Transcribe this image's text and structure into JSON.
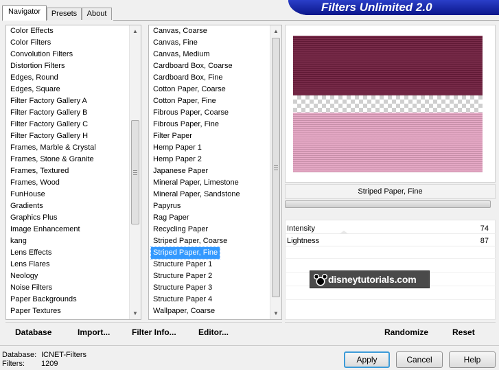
{
  "title": "Filters Unlimited 2.0",
  "tabs": [
    "Navigator",
    "Presets",
    "About"
  ],
  "categories": [
    "Color Effects",
    "Color Filters",
    "Convolution Filters",
    "Distortion Filters",
    "Edges, Round",
    "Edges, Square",
    "Filter Factory Gallery A",
    "Filter Factory Gallery B",
    "Filter Factory Gallery C",
    "Filter Factory Gallery H",
    "Frames, Marble & Crystal",
    "Frames, Stone & Granite",
    "Frames, Textured",
    "Frames, Wood",
    "FunHouse",
    "Gradients",
    "Graphics Plus",
    "Image Enhancement",
    "kang",
    "Lens Effects",
    "Lens Flares",
    "Neology",
    "Noise Filters",
    "Paper Backgrounds",
    "Paper Textures"
  ],
  "filters": [
    "Canvas, Coarse",
    "Canvas, Fine",
    "Canvas, Medium",
    "Cardboard Box, Coarse",
    "Cardboard Box, Fine",
    "Cotton Paper, Coarse",
    "Cotton Paper, Fine",
    "Fibrous Paper, Coarse",
    "Fibrous Paper, Fine",
    "Filter Paper",
    "Hemp Paper 1",
    "Hemp Paper 2",
    "Japanese Paper",
    "Mineral Paper, Limestone",
    "Mineral Paper, Sandstone",
    "Papyrus",
    "Rag Paper",
    "Recycling Paper",
    "Striped Paper, Coarse",
    "Striped Paper, Fine",
    "Structure Paper 1",
    "Structure Paper 2",
    "Structure Paper 3",
    "Structure Paper 4",
    "Wallpaper, Coarse"
  ],
  "selected_filter": "Striped Paper, Fine",
  "preview": {
    "top_color": "#6e1d3d",
    "bottom_color": "#e3a3c1"
  },
  "params": [
    {
      "label": "Intensity",
      "value": "74"
    },
    {
      "label": "Lightness",
      "value": "87"
    }
  ],
  "watermark": "disneytutorials.com",
  "list_buttons": {
    "database": "Database",
    "import": "Import...",
    "filter_info": "Filter Info...",
    "editor": "Editor..."
  },
  "right_buttons": {
    "randomize": "Randomize",
    "reset": "Reset"
  },
  "status": {
    "database_label": "Database:",
    "database_value": "ICNET-Filters",
    "filters_label": "Filters:",
    "filters_value": "1209"
  },
  "dialog_buttons": {
    "apply": "Apply",
    "cancel": "Cancel",
    "help": "Help"
  }
}
